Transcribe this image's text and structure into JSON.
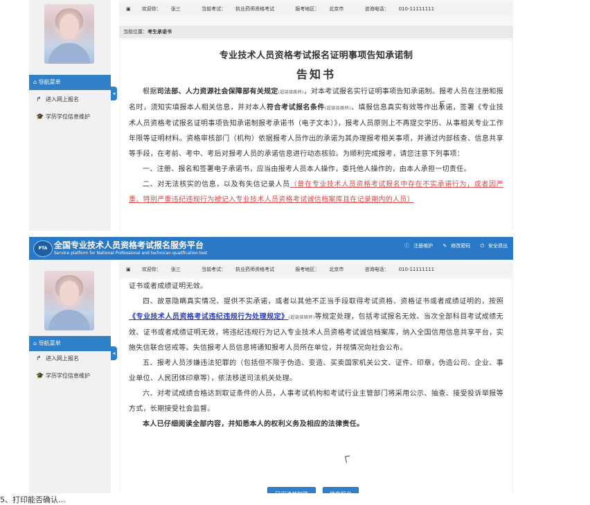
{
  "user": {
    "welcome_label": "欢迎你：",
    "name": "张三",
    "exam_label": "当前考试：",
    "exam": "执业药师资格考试",
    "region_label": "报考地区：",
    "region": "北京市",
    "phone_label": "咨询电话：",
    "phone": "010-11111111"
  },
  "breadcrumb": {
    "label": "当前位置：",
    "value": "考生承诺书"
  },
  "nav": {
    "header": "导航菜单",
    "items": [
      {
        "label": "进入网上报名"
      },
      {
        "label": "学历学位信息维护"
      }
    ],
    "collapse_glyph": "◂"
  },
  "header": {
    "logo_text": "PTA",
    "title_cn": "全国专业技术人员资格考试报名服务平台",
    "title_en": "Service platform for National Professional and technican qualification test",
    "links": [
      "注册维护",
      "修改密码",
      "安全退出"
    ]
  },
  "document": {
    "title_line1": "专业技术人员资格考试报名证明事项告知承诺制",
    "title_line2": "告知书",
    "p1_a": "根据",
    "p1_b": "司法部、人力资源社会保障部有关规定",
    "p1_tag1": "(超链接跳转)",
    "p1_c": "，对本考试报名实行证明事项告知承诺制。报考人员在注册和报名时，须知实填报本人相关信息，并对本人",
    "p1_d": "符合考试报名条件",
    "p1_tag2": "(超链接跳转)",
    "p1_e": "、填报信息真实有效等作出承诺，签署《专业技术人员资格考试报名证明事项告知承诺制报考承诺书（电子文本）》，报考人员原则上不再提交学历、从事相关专业工作年限等证明材料。资格审核部门（机构）依据报考人员作出的承诺为其办理报考相关事项，并通过内部核查、信息共享等手段，在考前、考中、考后对报考人员的承诺信息进行动态核验。为顺利完成报考，请您注意下列事项：",
    "p2": "一、注册、报名和签署电子承诺书，应当由报考人员本人操作，委托他人操作的，由本人承担一切责任。",
    "p3_a": "二、对无法核实的信息，以及有失信记录人员",
    "p3_b": "（曾在专业技术人员资格考试报名中存在不实承诺行为，或者因严重、特别严重违纪违规行为被记入专业技术人员资格考试诚信档案库且在记录期内的人员）",
    "q0": "证书或者成绩证明无效。",
    "q1_a": "四、故意隐瞒真实情况、提供不实承诺，或者以其他不正当手段取得考试资格、资格证书或者成绩证明的，按照",
    "q1_link": "《专业技术人员资格考试违纪违规行为处理规定》",
    "q1_tag": "(超链接跳转)",
    "q1_b": "等规定处理，包括考试报名无效、当次全部科目考试成绩无效、证书或者成绩证明无效，将违纪违规行为记入专业技术人员资格考试诚信档案库，纳入全国信用信息共享平台，实施失信联合惩戒等。失信报考人员信息将通知报考人员所在单位，并视情况向社会公布。",
    "q2": "五、报考人员涉嫌违法犯罪的（包括但不限于伪造、变造、买卖国家机关公文、证件、印章，伪造公司、企业、事业单位、人民团体印章等），依法移送司法机关处理。",
    "q3": "六、对考试成绩合格达到取证条件的人员，人事考试机构和考试行业主管部门将采用公示、抽查、接受投诉举报等方式，长期接受社会监督。",
    "q4": "本人已仔细阅读全部内容，并知悉本人的权利义务及相应的法律责任。"
  },
  "buttons": {
    "agree": "已阅读并知晓",
    "abandon": "放弃报名"
  },
  "bottom_fragment": "5、打印能否确认..."
}
